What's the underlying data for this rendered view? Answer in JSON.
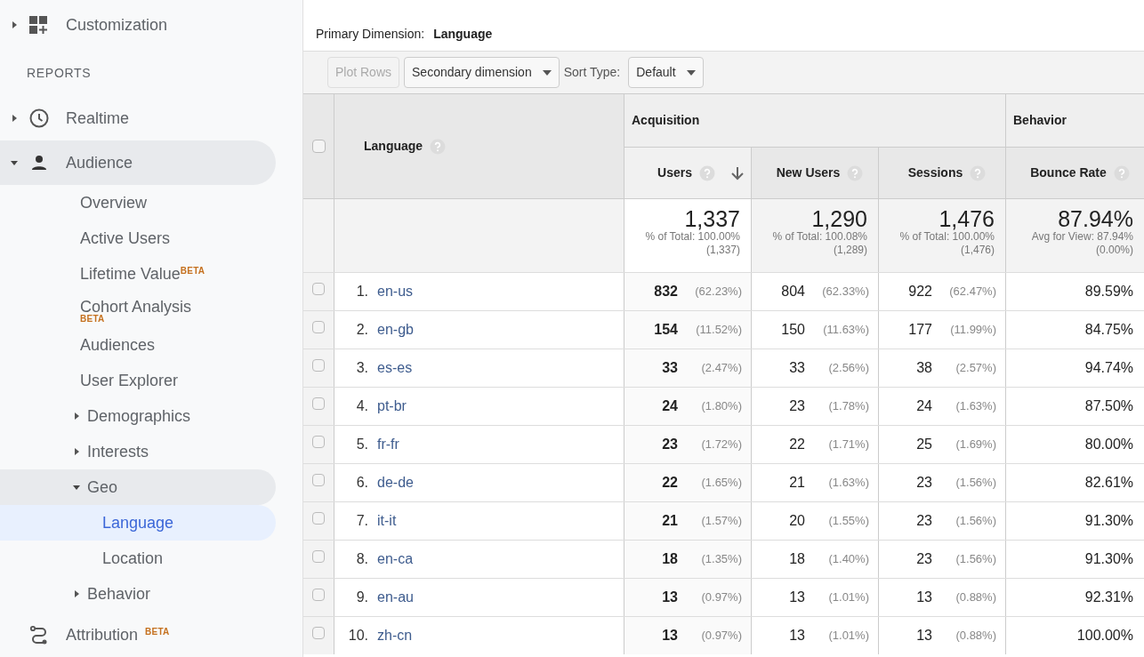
{
  "sidebar": {
    "customization": {
      "label": "Customization",
      "expanded": false
    },
    "section_heading": "REPORTS",
    "items": [
      {
        "label": "Realtime",
        "expanded": false,
        "selected": false
      },
      {
        "label": "Audience",
        "expanded": true,
        "selected": false,
        "children": [
          {
            "label": "Overview",
            "selected": false
          },
          {
            "label": "Active Users",
            "selected": false
          },
          {
            "label": "Lifetime Value",
            "selected": false,
            "badge": "BETA",
            "kind": "inline_badge"
          },
          {
            "label": "Cohort Analysis",
            "selected": false,
            "badge": "BETA",
            "kind": "stacked_badge"
          },
          {
            "label": "Audiences",
            "selected": false
          },
          {
            "label": "User Explorer",
            "selected": false
          },
          {
            "label": "Demographics",
            "selected": false,
            "expanded": false
          },
          {
            "label": "Interests",
            "selected": false,
            "expanded": false
          },
          {
            "label": "Geo",
            "selected": false,
            "expanded": true,
            "children": [
              {
                "label": "Language",
                "selected": true
              },
              {
                "label": "Location",
                "selected": false
              }
            ]
          },
          {
            "label": "Behavior",
            "selected": false,
            "expanded": false
          }
        ]
      },
      {
        "label": "Attribution",
        "selected": false,
        "badge": "BETA"
      }
    ]
  },
  "primary_dimension": {
    "label": "Primary Dimension:",
    "value": "Language"
  },
  "toolbar": {
    "plot_rows": {
      "label": "Plot Rows",
      "disabled": true
    },
    "secondary_dimension": "Secondary dimension",
    "sort_type_label": "Sort Type:",
    "sort_type": "Default"
  },
  "table": {
    "select_all_checked": false,
    "dimension_header": "Language",
    "groups": [
      {
        "label": "Acquisition"
      },
      {
        "label": "Behavior"
      }
    ],
    "columns": [
      {
        "label": "Users",
        "sorted": true
      },
      {
        "label": "New Users",
        "sorted": false
      },
      {
        "label": "Sessions",
        "sorted": false
      },
      {
        "label": "Bounce Rate",
        "sorted": false
      }
    ],
    "totals": [
      {
        "value": "1,337",
        "line_1": "% of Total: 100.00%",
        "line_2": "(1,337)"
      },
      {
        "value": "1,290",
        "line_1": "% of Total: 100.08%",
        "line_2": "(1,289)"
      },
      {
        "value": "1,476",
        "line_1": "% of Total: 100.00%",
        "line_2": "(1,476)"
      },
      {
        "value": "87.94%",
        "line_1": "Avg for View: 87.94%",
        "line_2": "(0.00%)"
      }
    ],
    "rows": [
      {
        "index": "1.",
        "language": "en-us",
        "checked": false,
        "users": "832",
        "users_pct": "(62.23%)",
        "new_users": "804",
        "new_users_pct": "(62.33%)",
        "sessions": "922",
        "sessions_pct": "(62.47%)",
        "bounce_rate": "89.59%"
      },
      {
        "index": "2.",
        "language": "en-gb",
        "checked": false,
        "users": "154",
        "users_pct": "(11.52%)",
        "new_users": "150",
        "new_users_pct": "(11.63%)",
        "sessions": "177",
        "sessions_pct": "(11.99%)",
        "bounce_rate": "84.75%"
      },
      {
        "index": "3.",
        "language": "es-es",
        "checked": false,
        "users": "33",
        "users_pct": "(2.47%)",
        "new_users": "33",
        "new_users_pct": "(2.56%)",
        "sessions": "38",
        "sessions_pct": "(2.57%)",
        "bounce_rate": "94.74%"
      },
      {
        "index": "4.",
        "language": "pt-br",
        "checked": false,
        "users": "24",
        "users_pct": "(1.80%)",
        "new_users": "23",
        "new_users_pct": "(1.78%)",
        "sessions": "24",
        "sessions_pct": "(1.63%)",
        "bounce_rate": "87.50%"
      },
      {
        "index": "5.",
        "language": "fr-fr",
        "checked": false,
        "users": "23",
        "users_pct": "(1.72%)",
        "new_users": "22",
        "new_users_pct": "(1.71%)",
        "sessions": "25",
        "sessions_pct": "(1.69%)",
        "bounce_rate": "80.00%"
      },
      {
        "index": "6.",
        "language": "de-de",
        "checked": false,
        "users": "22",
        "users_pct": "(1.65%)",
        "new_users": "21",
        "new_users_pct": "(1.63%)",
        "sessions": "23",
        "sessions_pct": "(1.56%)",
        "bounce_rate": "82.61%"
      },
      {
        "index": "7.",
        "language": "it-it",
        "checked": false,
        "users": "21",
        "users_pct": "(1.57%)",
        "new_users": "20",
        "new_users_pct": "(1.55%)",
        "sessions": "23",
        "sessions_pct": "(1.56%)",
        "bounce_rate": "91.30%"
      },
      {
        "index": "8.",
        "language": "en-ca",
        "checked": false,
        "users": "18",
        "users_pct": "(1.35%)",
        "new_users": "18",
        "new_users_pct": "(1.40%)",
        "sessions": "23",
        "sessions_pct": "(1.56%)",
        "bounce_rate": "91.30%"
      },
      {
        "index": "9.",
        "language": "en-au",
        "checked": false,
        "users": "13",
        "users_pct": "(0.97%)",
        "new_users": "13",
        "new_users_pct": "(1.01%)",
        "sessions": "13",
        "sessions_pct": "(0.88%)",
        "bounce_rate": "92.31%"
      },
      {
        "index": "10.",
        "language": "zh-cn",
        "checked": false,
        "users": "13",
        "users_pct": "(0.97%)",
        "new_users": "13",
        "new_users_pct": "(1.01%)",
        "sessions": "13",
        "sessions_pct": "(0.88%)",
        "bounce_rate": "100.00%"
      }
    ]
  }
}
